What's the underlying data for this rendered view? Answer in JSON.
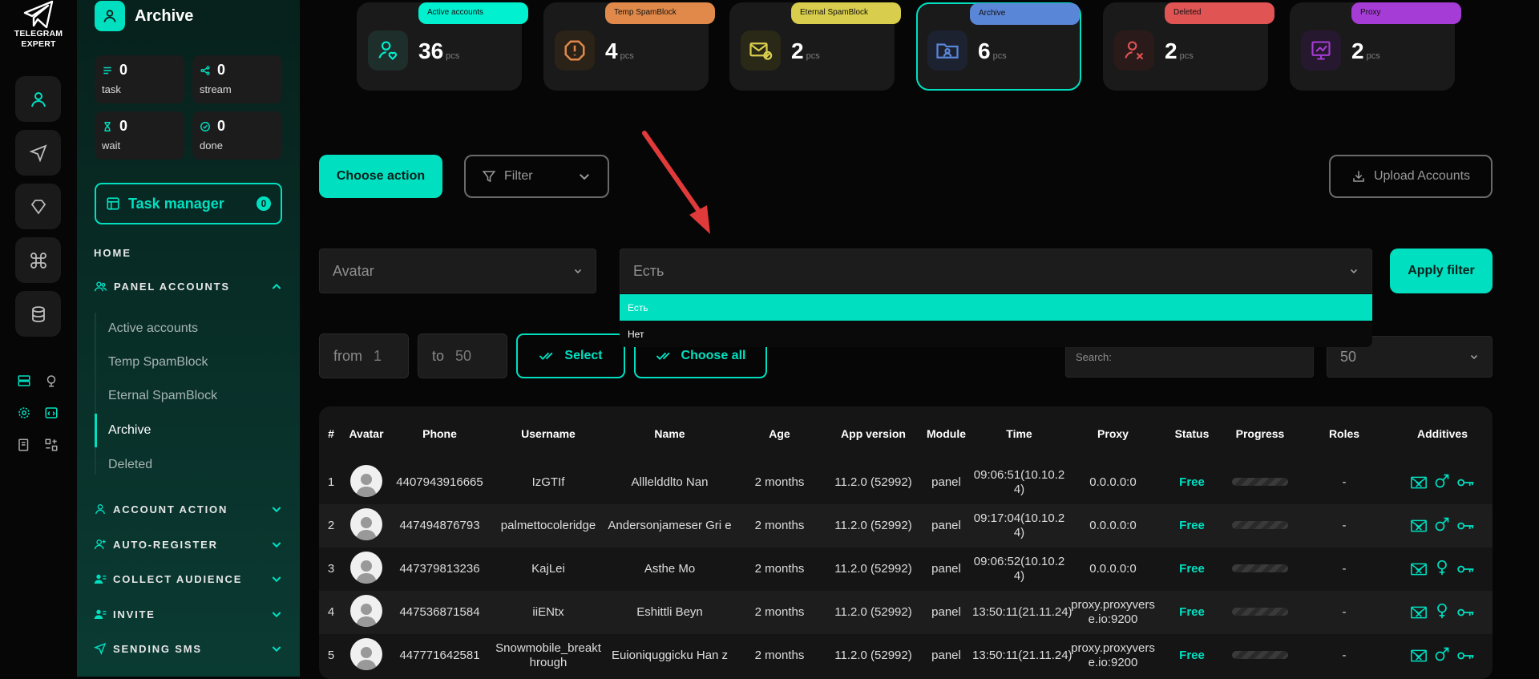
{
  "logo": {
    "line1": "TELEGRAM",
    "line2": "EXPERT"
  },
  "sidebar": {
    "title": "Archive",
    "stats": [
      {
        "value": "0",
        "label": "task",
        "icon": "list-icon"
      },
      {
        "value": "0",
        "label": "stream",
        "icon": "share-icon"
      },
      {
        "value": "0",
        "label": "wait",
        "icon": "hourglass-icon"
      },
      {
        "value": "0",
        "label": "done",
        "icon": "check-circle-icon"
      }
    ],
    "task_manager": {
      "label": "Task manager",
      "count": "0"
    },
    "home": "HOME",
    "sections": [
      "PANEL ACCOUNTS",
      "ACCOUNT ACTION",
      "AUTO-REGISTER",
      "COLLECT AUDIENCE",
      "INVITE",
      "SENDING SMS"
    ],
    "sub_items": [
      "Active accounts",
      "Temp SpamBlock",
      "Eternal SpamBlock",
      "Archive",
      "Deleted"
    ],
    "active_sub": "Archive"
  },
  "cards": [
    {
      "badge": "Active accounts",
      "value": "36",
      "unit": "pcs",
      "color": "#00f0d0",
      "icon": "user-heart-icon"
    },
    {
      "badge": "Temp SpamBlock",
      "value": "4",
      "unit": "pcs",
      "color": "#e0894a",
      "icon": "alert-icon"
    },
    {
      "badge": "Eternal SpamBlock",
      "value": "2",
      "unit": "pcs",
      "color": "#d8cd4c",
      "icon": "mail-block-icon"
    },
    {
      "badge": "Archive",
      "value": "6",
      "unit": "pcs",
      "color": "#5a86d8",
      "icon": "folder-user-icon"
    },
    {
      "badge": "Deleted",
      "value": "2",
      "unit": "pcs",
      "color": "#e05454",
      "icon": "user-x-icon"
    },
    {
      "badge": "Proxy",
      "value": "2",
      "unit": "pcs",
      "color": "#a63cd6",
      "icon": "proxy-icon"
    }
  ],
  "toolbar": {
    "choose_action": "Choose action",
    "filter": "Filter",
    "upload": "Upload Accounts"
  },
  "filter": {
    "field": "Avatar",
    "value": "Есть",
    "options": [
      "Есть",
      "Нет"
    ],
    "apply": "Apply filter"
  },
  "range": {
    "from_label": "from",
    "from_value": "1",
    "to_label": "to",
    "to_value": "50",
    "select": "Select",
    "choose_all": "Choose all"
  },
  "search": {
    "placeholder": "Search:"
  },
  "per_page": "50",
  "table": {
    "headers": [
      "#",
      "Avatar",
      "Phone",
      "Username",
      "Name",
      "Age",
      "App version",
      "Module",
      "Time",
      "Proxy",
      "Status",
      "Progress",
      "Roles",
      "Additives"
    ],
    "rows": [
      {
        "n": "1",
        "phone": "4407943916665",
        "username": "IzGTIf",
        "name": "Alllelddlto Nan",
        "age": "2 months",
        "app": "11.2.0 (52992)",
        "module": "panel",
        "time": "09:06:51(10.10.2 4)",
        "proxy": "0.0.0.0:0",
        "status": "Free",
        "roles": "-",
        "gender": "male"
      },
      {
        "n": "2",
        "phone": "447494876793",
        "username": "palmettocoleridge",
        "name": "Andersonjameser Gri e",
        "age": "2 months",
        "app": "11.2.0 (52992)",
        "module": "panel",
        "time": "09:17:04(10.10.2 4)",
        "proxy": "0.0.0.0:0",
        "status": "Free",
        "roles": "-",
        "gender": "male"
      },
      {
        "n": "3",
        "phone": "447379813236",
        "username": "KajLei",
        "name": "Asthe Mo",
        "age": "2 months",
        "app": "11.2.0 (52992)",
        "module": "panel",
        "time": "09:06:52(10.10.2 4)",
        "proxy": "0.0.0.0:0",
        "status": "Free",
        "roles": "-",
        "gender": "female"
      },
      {
        "n": "4",
        "phone": "447536871584",
        "username": "iiENtx",
        "name": "Eshittli Beyn",
        "age": "2 months",
        "app": "11.2.0 (52992)",
        "module": "panel",
        "time": "13:50:11(21.11.24)",
        "proxy": "proxy.proxyvers e.io:9200",
        "status": "Free",
        "roles": "-",
        "gender": "female"
      },
      {
        "n": "5",
        "phone": "447771642581",
        "username": "Snowmobile_breakt hrough",
        "name": "Euioniquggicku Han z",
        "age": "2 months",
        "app": "11.2.0 (52992)",
        "module": "panel",
        "time": "13:50:11(21.11.24)",
        "proxy": "proxy.proxyvers e.io:9200",
        "status": "Free",
        "roles": "-",
        "gender": "male"
      }
    ]
  },
  "accent": "#00e0c1"
}
